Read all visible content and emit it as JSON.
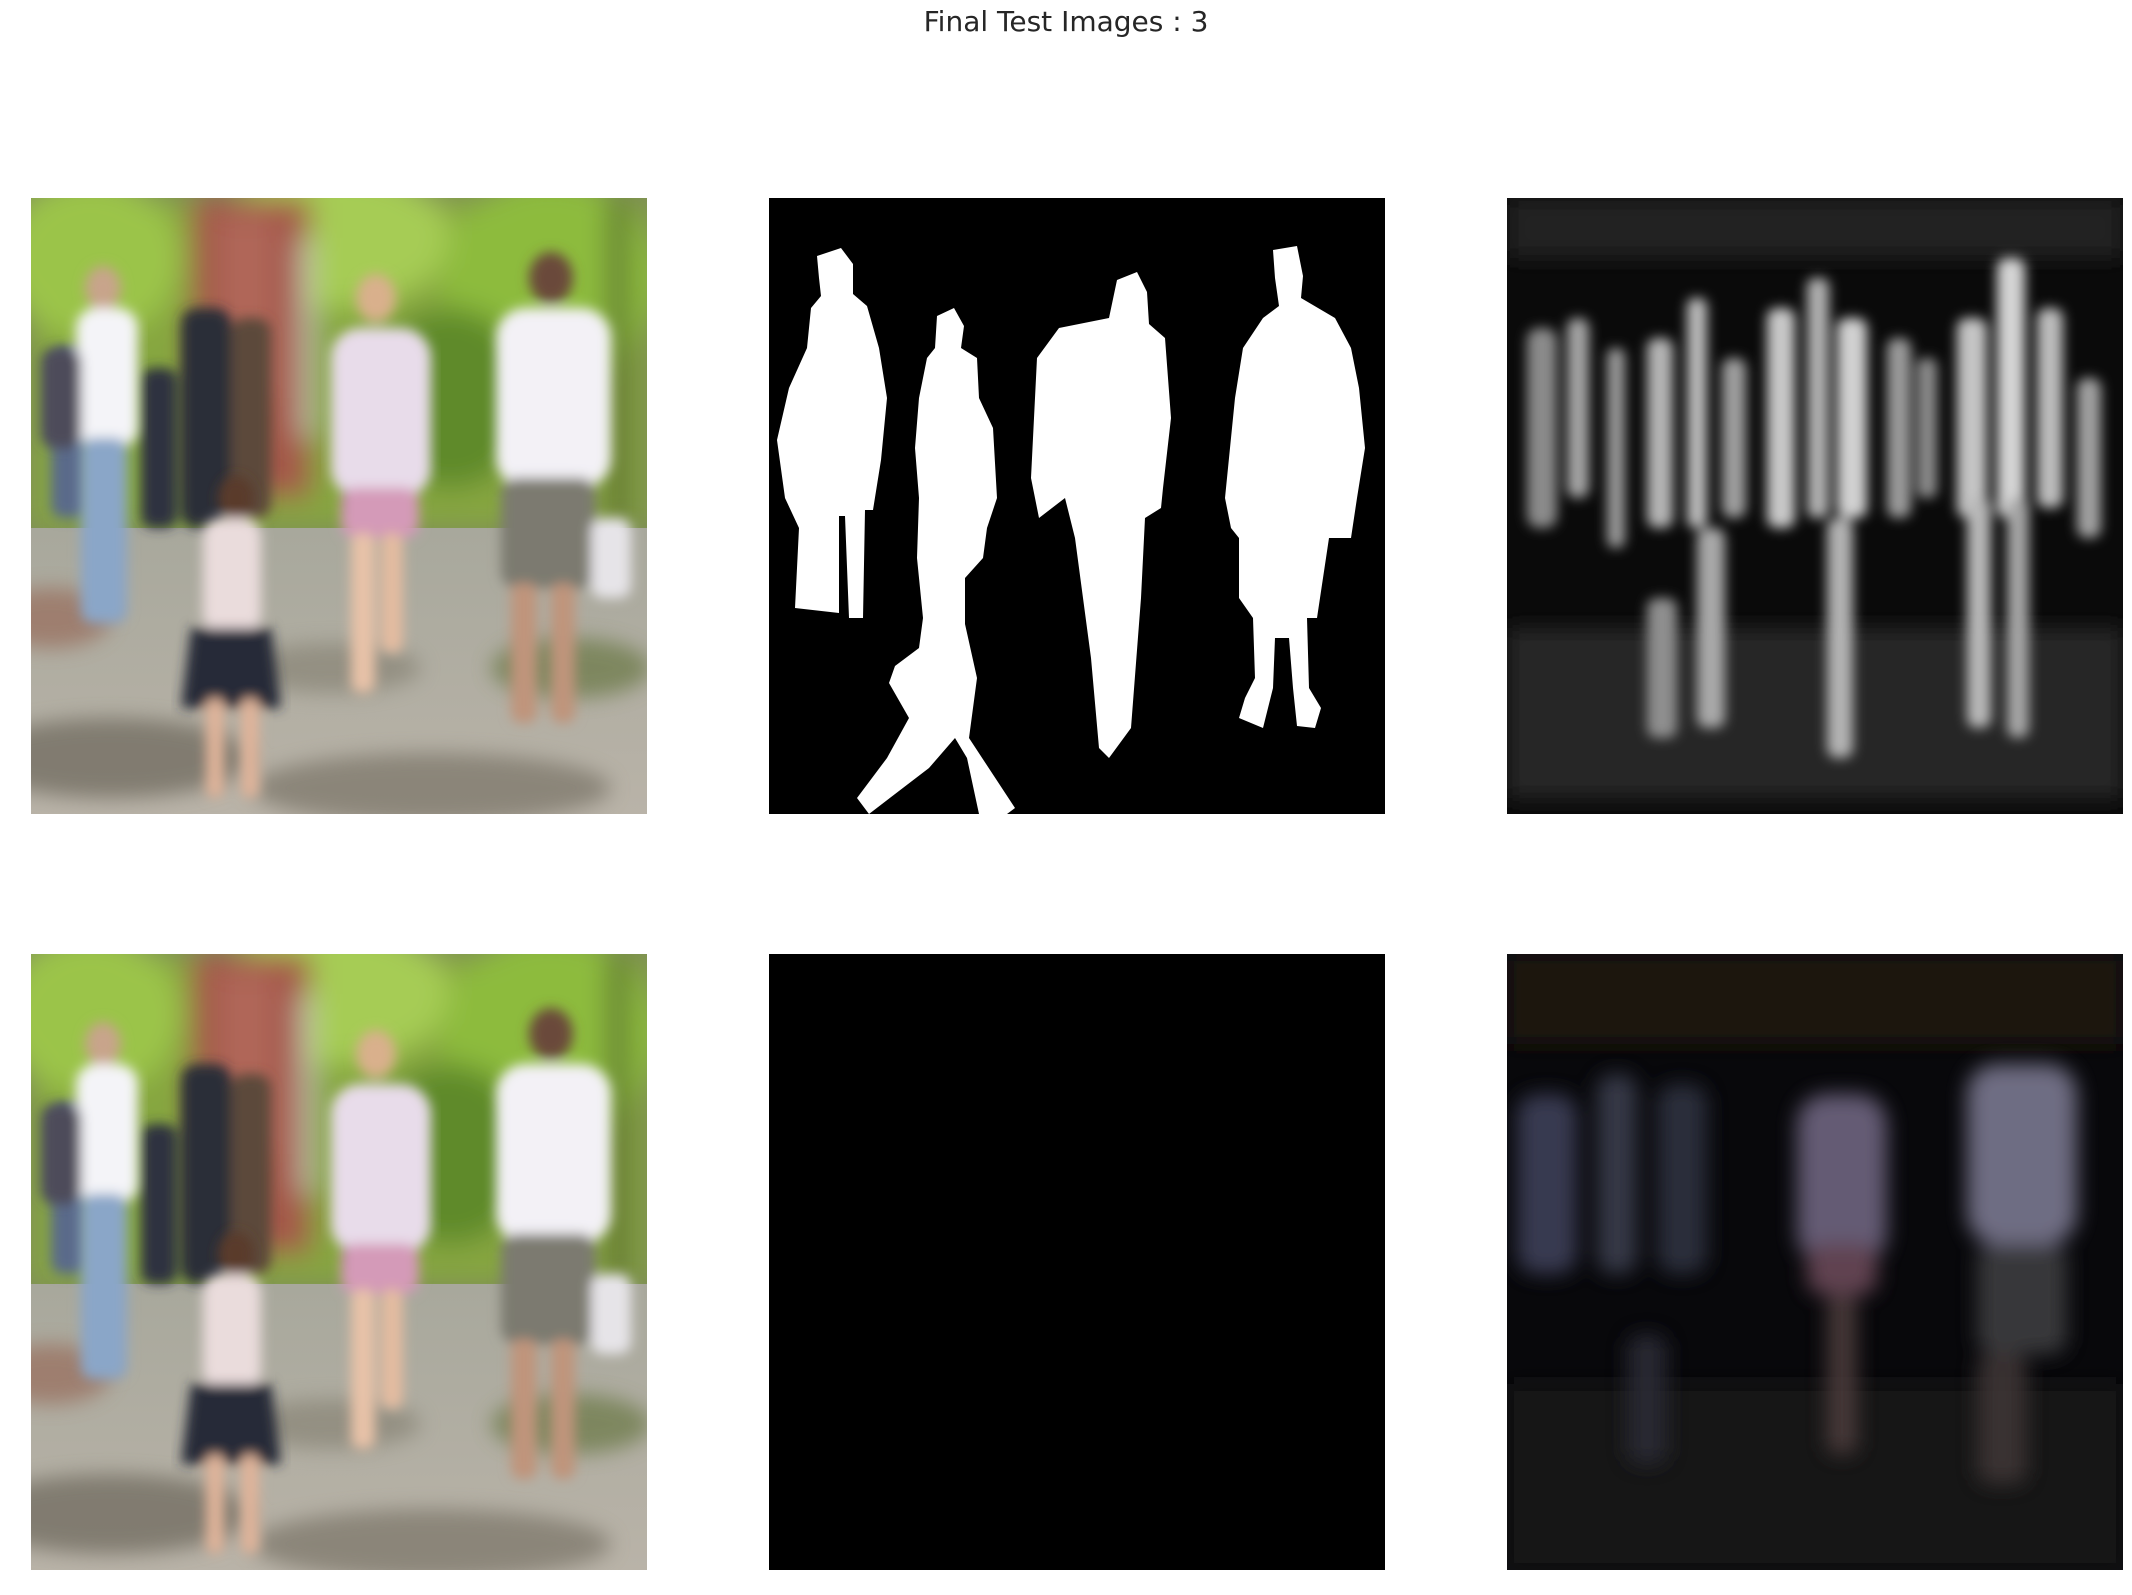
{
  "figure": {
    "title": "Final Test Images : 3"
  },
  "panels": [
    {
      "id": "input-image",
      "row": 0,
      "col": 0,
      "kind": "rgb-photo",
      "depicts": "pedestrian-scene"
    },
    {
      "id": "ground-truth-mask",
      "row": 0,
      "col": 1,
      "kind": "binary-mask",
      "depicts": "pedestrian-silhouettes"
    },
    {
      "id": "predicted-mask",
      "row": 0,
      "col": 2,
      "kind": "grayscale-prediction",
      "depicts": "blurry-pedestrian-response"
    },
    {
      "id": "input-image-repeat",
      "row": 1,
      "col": 0,
      "kind": "rgb-photo",
      "depicts": "pedestrian-scene"
    },
    {
      "id": "ground-truth-overlay",
      "row": 1,
      "col": 1,
      "kind": "masked-rgb",
      "depicts": "pedestrians-on-black"
    },
    {
      "id": "predicted-overlay",
      "row": 1,
      "col": 2,
      "kind": "masked-rgb-dark",
      "depicts": "dark-pedestrian-response"
    }
  ],
  "colors": {
    "background": "#ffffff",
    "title_text": "#262626",
    "mask_background": "#000000",
    "mask_foreground": "#ffffff"
  }
}
